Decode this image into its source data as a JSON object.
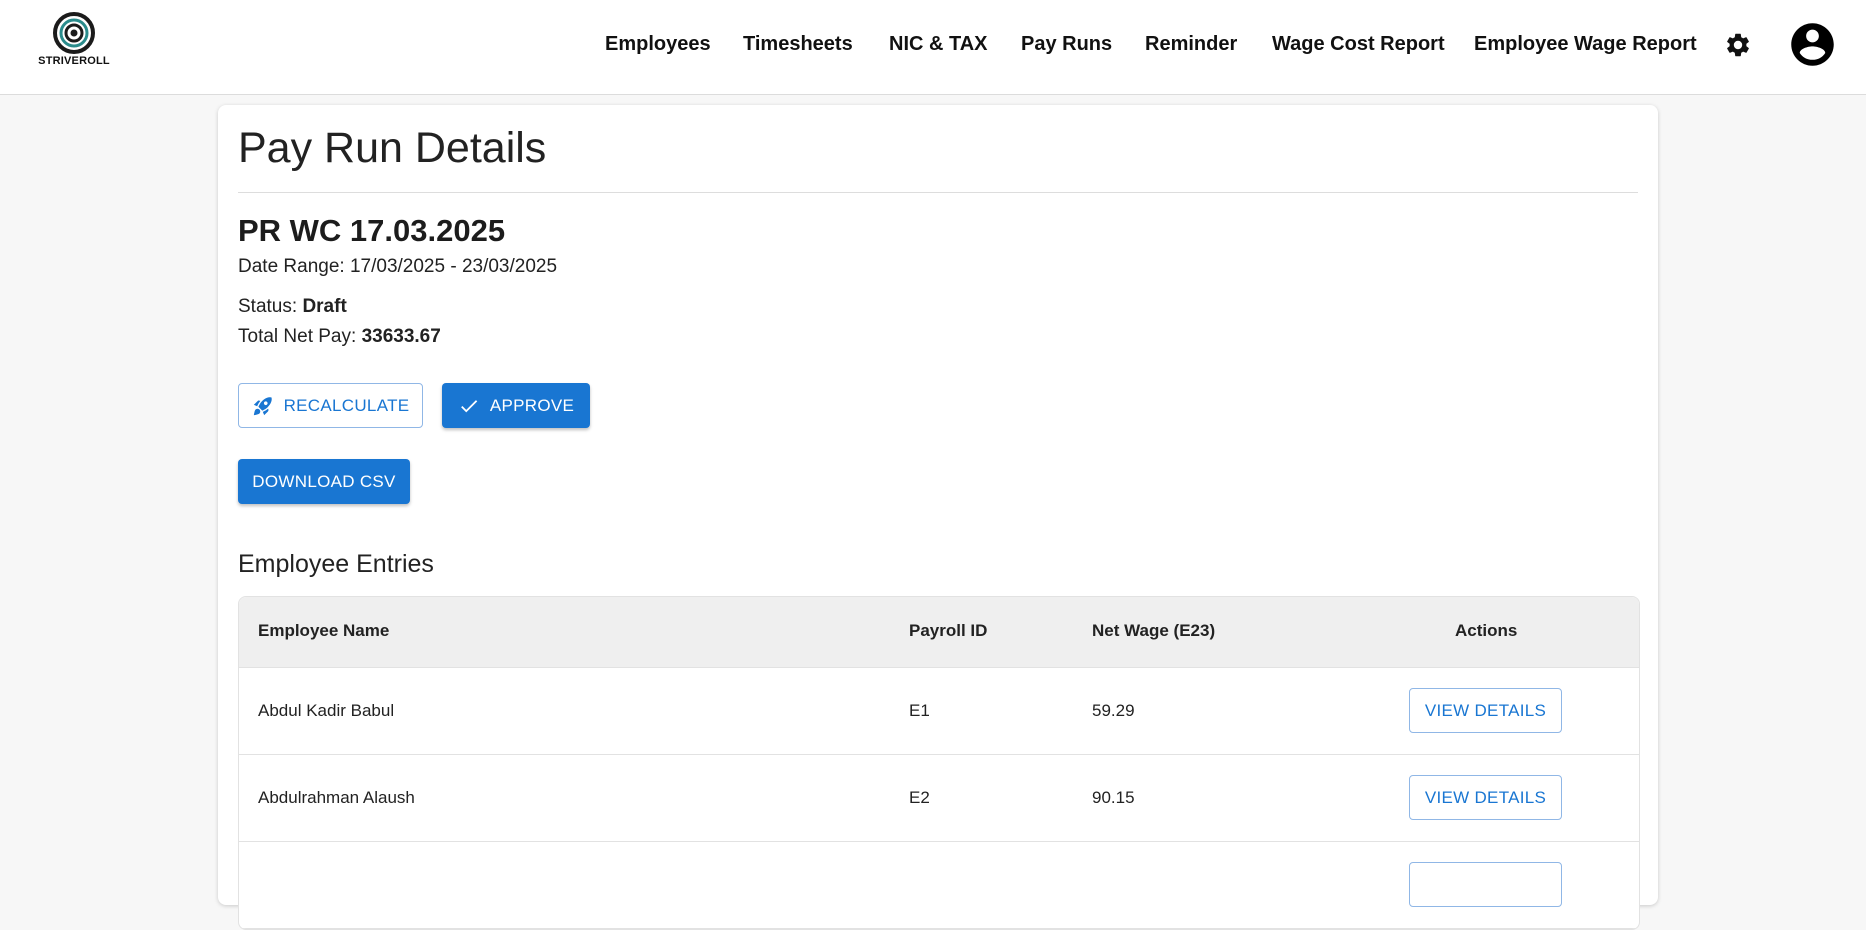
{
  "brand": {
    "name": "STRIVEROLL"
  },
  "nav": {
    "items": [
      {
        "label": "Employees"
      },
      {
        "label": "Timesheets"
      },
      {
        "label": "NIC & TAX"
      },
      {
        "label": "Pay Runs"
      },
      {
        "label": "Reminder"
      },
      {
        "label": "Wage Cost Report"
      },
      {
        "label": "Employee Wage Report"
      }
    ],
    "settings_icon": "gear-icon",
    "account_icon": "account-circle-icon"
  },
  "page": {
    "title": "Pay Run Details",
    "payrun_name": "PR WC 17.03.2025",
    "date_range_label": "Date Range:",
    "date_range_value": "17/03/2025 - 23/03/2025",
    "status_label": "Status:",
    "status_value": "Draft",
    "total_net_pay_label": "Total Net Pay:",
    "total_net_pay_value": "33633.67"
  },
  "actions": {
    "recalculate_label": "RECALCULATE",
    "recalculate_icon": "rocket-icon",
    "approve_label": "APPROVE",
    "approve_icon": "check-icon",
    "download_csv_label": "DOWNLOAD CSV"
  },
  "entries": {
    "title": "Employee Entries",
    "columns": [
      "Employee Name",
      "Payroll ID",
      "Net Wage (E23)",
      "Actions"
    ],
    "rows": [
      {
        "name": "Abdul Kadir Babul",
        "payroll_id": "E1",
        "net_wage": "59.29",
        "action_label": "VIEW DETAILS"
      },
      {
        "name": "Abdulrahman Alaush",
        "payroll_id": "E2",
        "net_wage": "90.15",
        "action_label": "VIEW DETAILS"
      },
      {
        "name": "",
        "payroll_id": "",
        "net_wage": "",
        "action_label": ""
      }
    ]
  },
  "colors": {
    "primary": "#1976d2",
    "header_bg": "#efefef",
    "page_bg": "#f7f7f7"
  }
}
